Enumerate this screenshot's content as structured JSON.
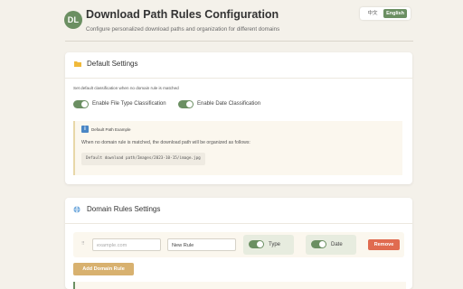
{
  "header": {
    "logo_text": "DL",
    "title": "Download Path Rules Configuration",
    "subtitle": "Configure personalized download paths and organization for different domains",
    "languages": {
      "zh": "中文",
      "en": "English",
      "active": "en"
    }
  },
  "default_settings": {
    "title": "Default Settings",
    "description": "Set default classification when no domain rule is matched",
    "toggles": [
      {
        "label": "Enable File Type Classification",
        "on": true
      },
      {
        "label": "Enable Date Classification",
        "on": true
      }
    ],
    "example": {
      "title": "Default Path Example",
      "description": "When no domain rule is matched, the download path will be organized as follows:",
      "path": "Default download path/Images/2023-10-15/image.jpg"
    }
  },
  "domain_rules": {
    "title": "Domain Rules Settings",
    "rules": [
      {
        "domain_value": "",
        "domain_placeholder": "example.com",
        "name_value": "New Rule",
        "type_label": "Type",
        "type_on": true,
        "date_label": "Date",
        "date_on": true,
        "remove_label": "Remove"
      }
    ],
    "add_label": "Add Domain Rule"
  },
  "colors": {
    "accent": "#6b8f62",
    "remove": "#e06b50",
    "add": "#d8b16f",
    "background": "#f4f1ea"
  },
  "icons": {
    "default_settings": "folder-icon",
    "domain_rules": "globe-icon",
    "example": "info-icon"
  }
}
